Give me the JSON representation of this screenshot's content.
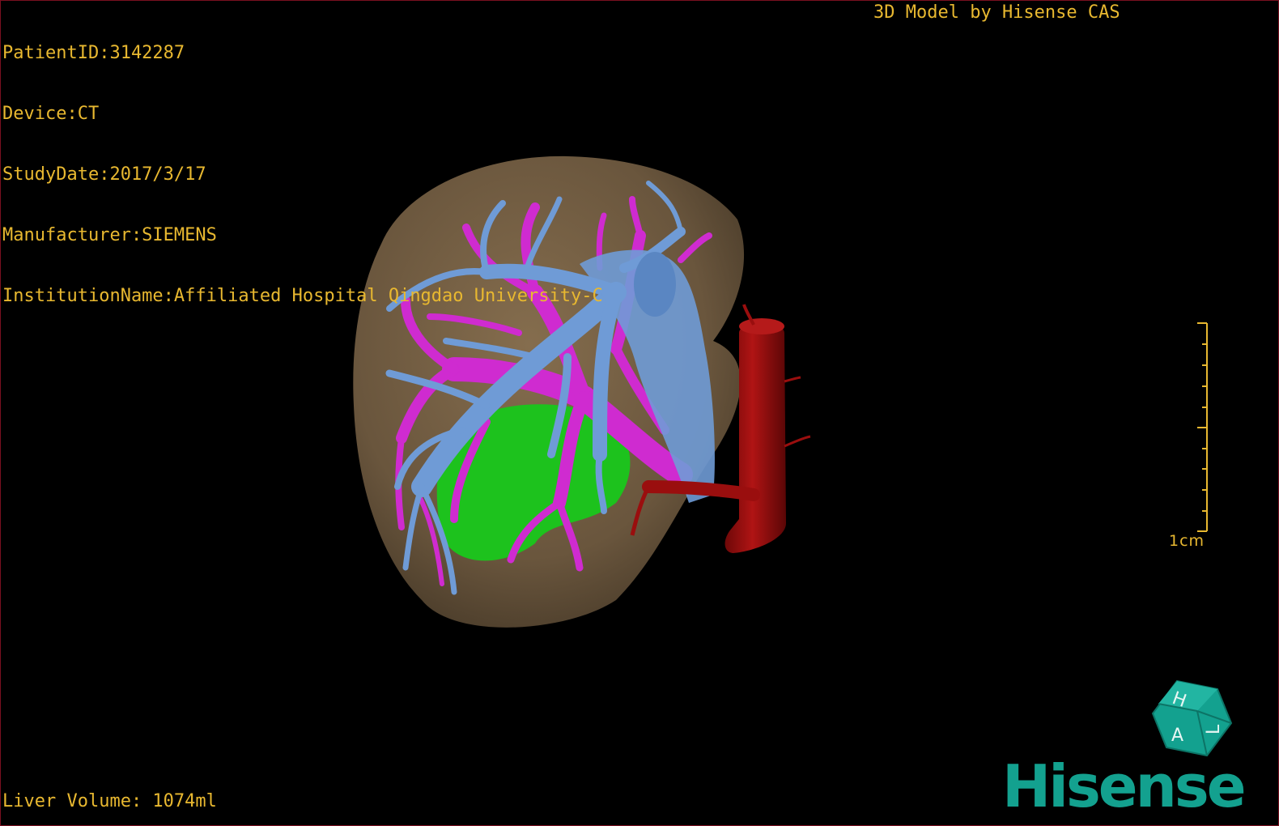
{
  "overlay": {
    "patient_id": "PatientID:3142287",
    "device": "Device:CT",
    "study_date": "StudyDate:2017/3/17",
    "manufacturer": "Manufacturer:SIEMENS",
    "institution": "InstitutionName:Affiliated Hospital Qingdao University-C",
    "credit": "3D Model by Hisense CAS",
    "liver_volume": "Liver Volume: 1074ml"
  },
  "scale_bar": {
    "label": "1cm"
  },
  "orientation_cube": {
    "faces": [
      "H",
      "A",
      "L"
    ]
  },
  "brand": {
    "logo_text": "Hisense"
  },
  "colors": {
    "overlay_text": "#e8b830",
    "liver": "#7a6247",
    "hepatic_vein": "#6f9bd6",
    "portal_vein": "#cf2bd0",
    "tumor": "#1dc21d",
    "ivc": "#9a0e0e",
    "brand": "#13a18f"
  }
}
